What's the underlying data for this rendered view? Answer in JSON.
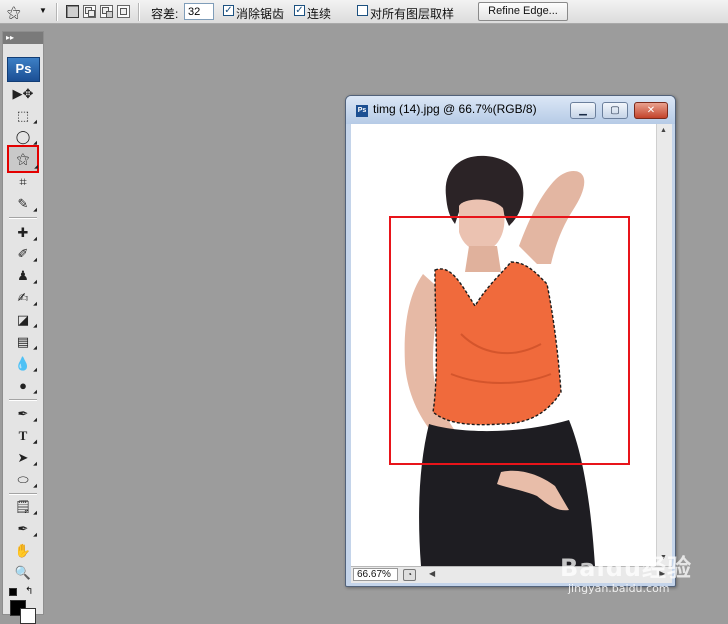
{
  "options_bar": {
    "tolerance_label": "容差:",
    "tolerance_value": "32",
    "antialias_label": "消除锯齿",
    "antialias_checked": true,
    "contiguous_label": "连续",
    "contiguous_checked": true,
    "sample_all_layers_label": "对所有图层取样",
    "sample_all_layers_checked": false,
    "refine_edge_label": "Refine Edge..."
  },
  "toolbox": {
    "logo": "Ps",
    "active_tool": "magic-wand-tool",
    "highlight_color": "#e40000",
    "tools": [
      {
        "name": "move-tool",
        "glyph": "▶✥"
      },
      {
        "name": "marquee-tool",
        "glyph": "⬚"
      },
      {
        "name": "lasso-tool",
        "glyph": "◯"
      },
      {
        "name": "magic-wand-tool",
        "glyph": "⚝"
      },
      {
        "name": "crop-tool",
        "glyph": "⌗"
      },
      {
        "name": "slice-tool",
        "glyph": "✎"
      },
      {
        "name": "healing-brush-tool",
        "glyph": "✚"
      },
      {
        "name": "brush-tool",
        "glyph": "✐"
      },
      {
        "name": "clone-stamp-tool",
        "glyph": "♟"
      },
      {
        "name": "history-brush-tool",
        "glyph": "✍"
      },
      {
        "name": "eraser-tool",
        "glyph": "◪"
      },
      {
        "name": "gradient-tool",
        "glyph": "▤"
      },
      {
        "name": "blur-tool",
        "glyph": "💧"
      },
      {
        "name": "dodge-tool",
        "glyph": "●"
      },
      {
        "name": "pen-tool",
        "glyph": "✒"
      },
      {
        "name": "type-tool",
        "glyph": "T"
      },
      {
        "name": "path-selection-tool",
        "glyph": "➤"
      },
      {
        "name": "shape-tool",
        "glyph": "⬭"
      },
      {
        "name": "notes-tool",
        "glyph": "🗒"
      },
      {
        "name": "eyedropper-tool",
        "glyph": "✒"
      },
      {
        "name": "hand-tool",
        "glyph": "✋"
      },
      {
        "name": "zoom-tool",
        "glyph": "🔍"
      }
    ]
  },
  "document": {
    "title": "timg (14).jpg @ 66.7%(RGB/8)",
    "zoom": "66.67%",
    "minimize_glyph": "▁",
    "maximize_glyph": "▢",
    "close_glyph": "✕"
  },
  "annotation_color": "#e8141a",
  "top_tab_glyph": "▸▸",
  "watermark": {
    "text": "Baidu经验",
    "url": "jingyan.baidu.com"
  }
}
